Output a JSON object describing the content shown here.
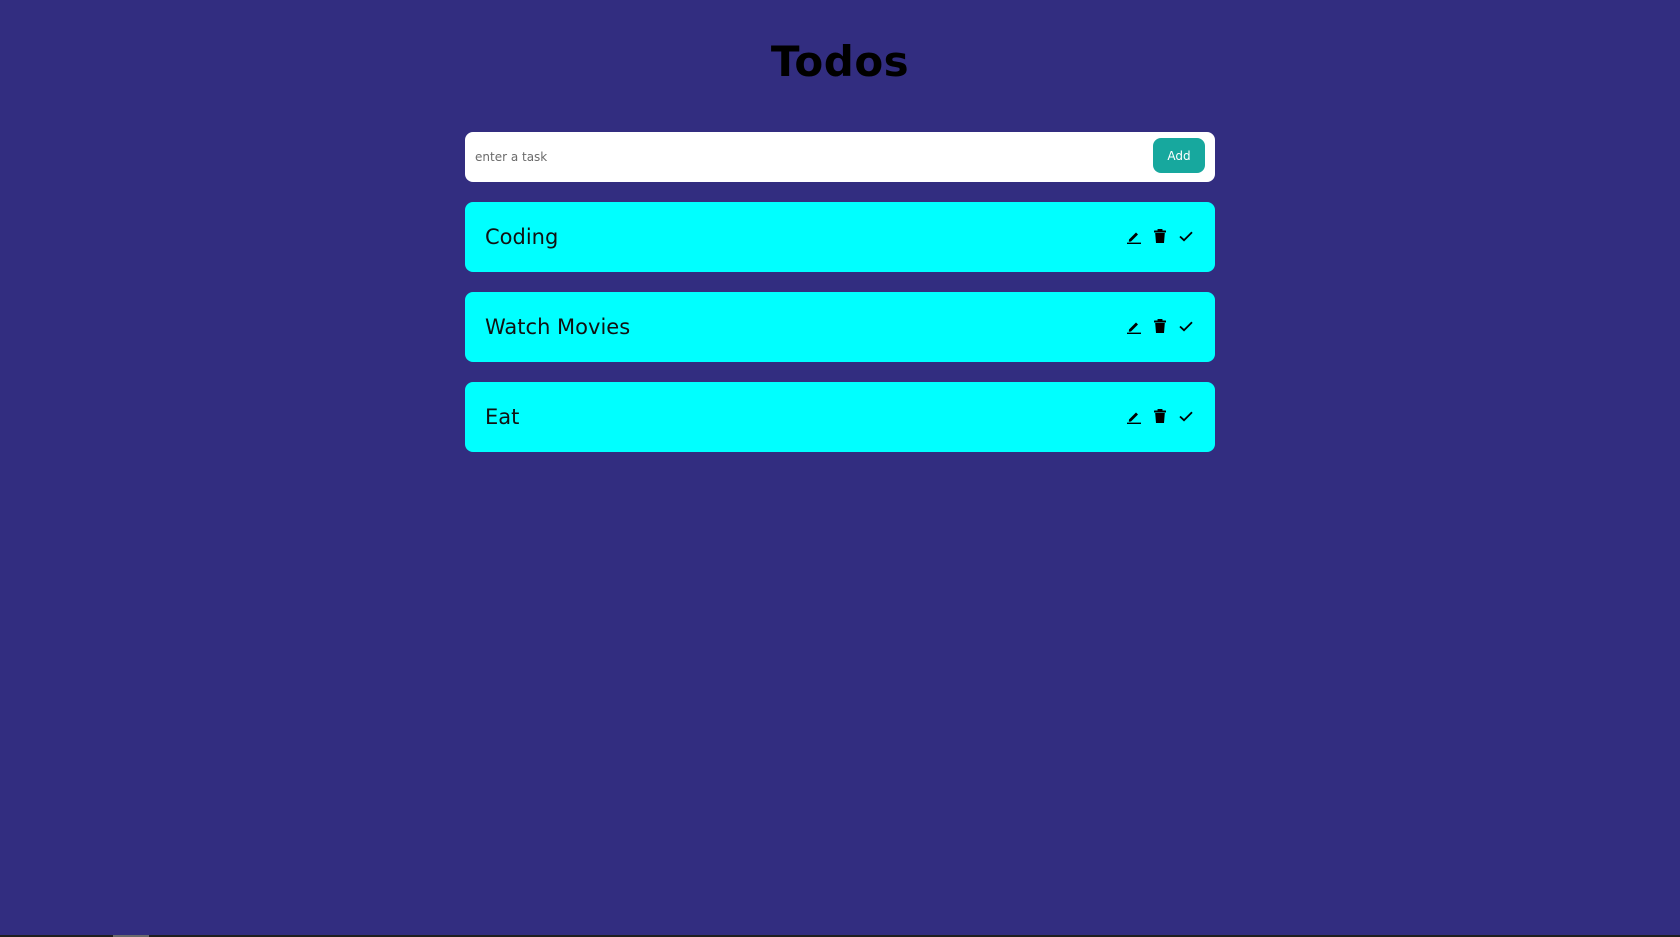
{
  "header": {
    "title": "Todos"
  },
  "form": {
    "input_value": "",
    "input_placeholder": "enter a task",
    "add_label": "Add"
  },
  "todos": [
    {
      "text": "Coding"
    },
    {
      "text": "Watch Movies"
    },
    {
      "text": "Eat"
    }
  ],
  "icons": {
    "edit": "pencil-icon",
    "delete": "trash-icon",
    "done": "check-icon"
  },
  "colors": {
    "background": "#322d80",
    "todo_background": "#00ffff",
    "add_button": "#17a89e",
    "text": "#111111"
  }
}
